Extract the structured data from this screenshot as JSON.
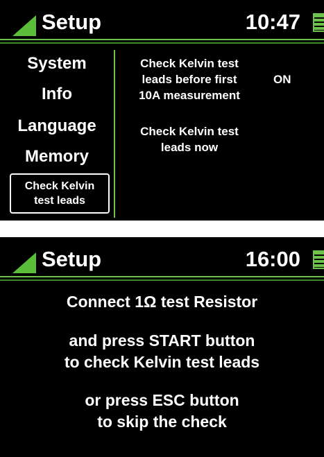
{
  "colors": {
    "background": "#000000",
    "text": "#ffffff",
    "accent_green": "#6fc24a"
  },
  "screen1": {
    "header": {
      "title": "Setup",
      "time": "10:47",
      "icons": [
        "setup-triangle-icon",
        "battery-icon"
      ]
    },
    "sidebar": {
      "items": [
        {
          "label": "System"
        },
        {
          "label": "Info"
        },
        {
          "label": "Language"
        },
        {
          "label": "Memory"
        }
      ],
      "selected": {
        "line1": "Check Kelvin",
        "line2": "test leads"
      }
    },
    "content": {
      "option1": {
        "line1": "Check Kelvin test",
        "line2": "leads before first",
        "line3": "10A measurement",
        "value": "ON"
      },
      "option2": {
        "line1": "Check Kelvin test",
        "line2": "leads now"
      }
    }
  },
  "screen2": {
    "header": {
      "title": "Setup",
      "time": "16:00",
      "icons": [
        "setup-triangle-icon",
        "battery-icon"
      ]
    },
    "message": {
      "line1": "Connect 1Ω test Resistor",
      "line2": "and press START button",
      "line3": "to check Kelvin test leads",
      "line4": "or press ESC button",
      "line5": "to skip the check"
    }
  }
}
